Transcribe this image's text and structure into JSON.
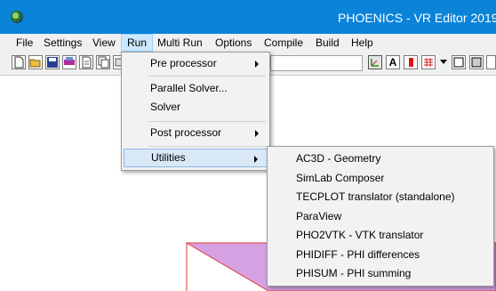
{
  "window": {
    "title": "PHOENICS - VR Editor 2019"
  },
  "menubar": [
    {
      "label": "File"
    },
    {
      "label": "Settings"
    },
    {
      "label": "View"
    },
    {
      "label": "Run"
    },
    {
      "label": "Multi Run"
    },
    {
      "label": "Options"
    },
    {
      "label": "Compile"
    },
    {
      "label": "Build"
    },
    {
      "label": "Help"
    }
  ],
  "run_menu": {
    "items": [
      {
        "label": "Pre processor"
      },
      {
        "label": "Parallel Solver..."
      },
      {
        "label": "Solver"
      },
      {
        "label": "Post processor"
      },
      {
        "label": "Utilities"
      }
    ]
  },
  "utilities_menu": {
    "items": [
      {
        "label": "AC3D - Geometry"
      },
      {
        "label": "SimLab Composer"
      },
      {
        "label": "TECPLOT translator (standalone)"
      },
      {
        "label": "ParaView"
      },
      {
        "label": "PHO2VTK - VTK translator"
      },
      {
        "label": "PHIDIFF - PHI differences"
      },
      {
        "label": "PHISUM - PHI summing"
      }
    ]
  },
  "toolbar": {
    "right_letter": "A"
  },
  "colors": {
    "titlebar": "#0a83d8",
    "highlight": "#d9e8f7",
    "shape_fill": "#d6a1e3",
    "shape_edge": "#e03a3a"
  }
}
